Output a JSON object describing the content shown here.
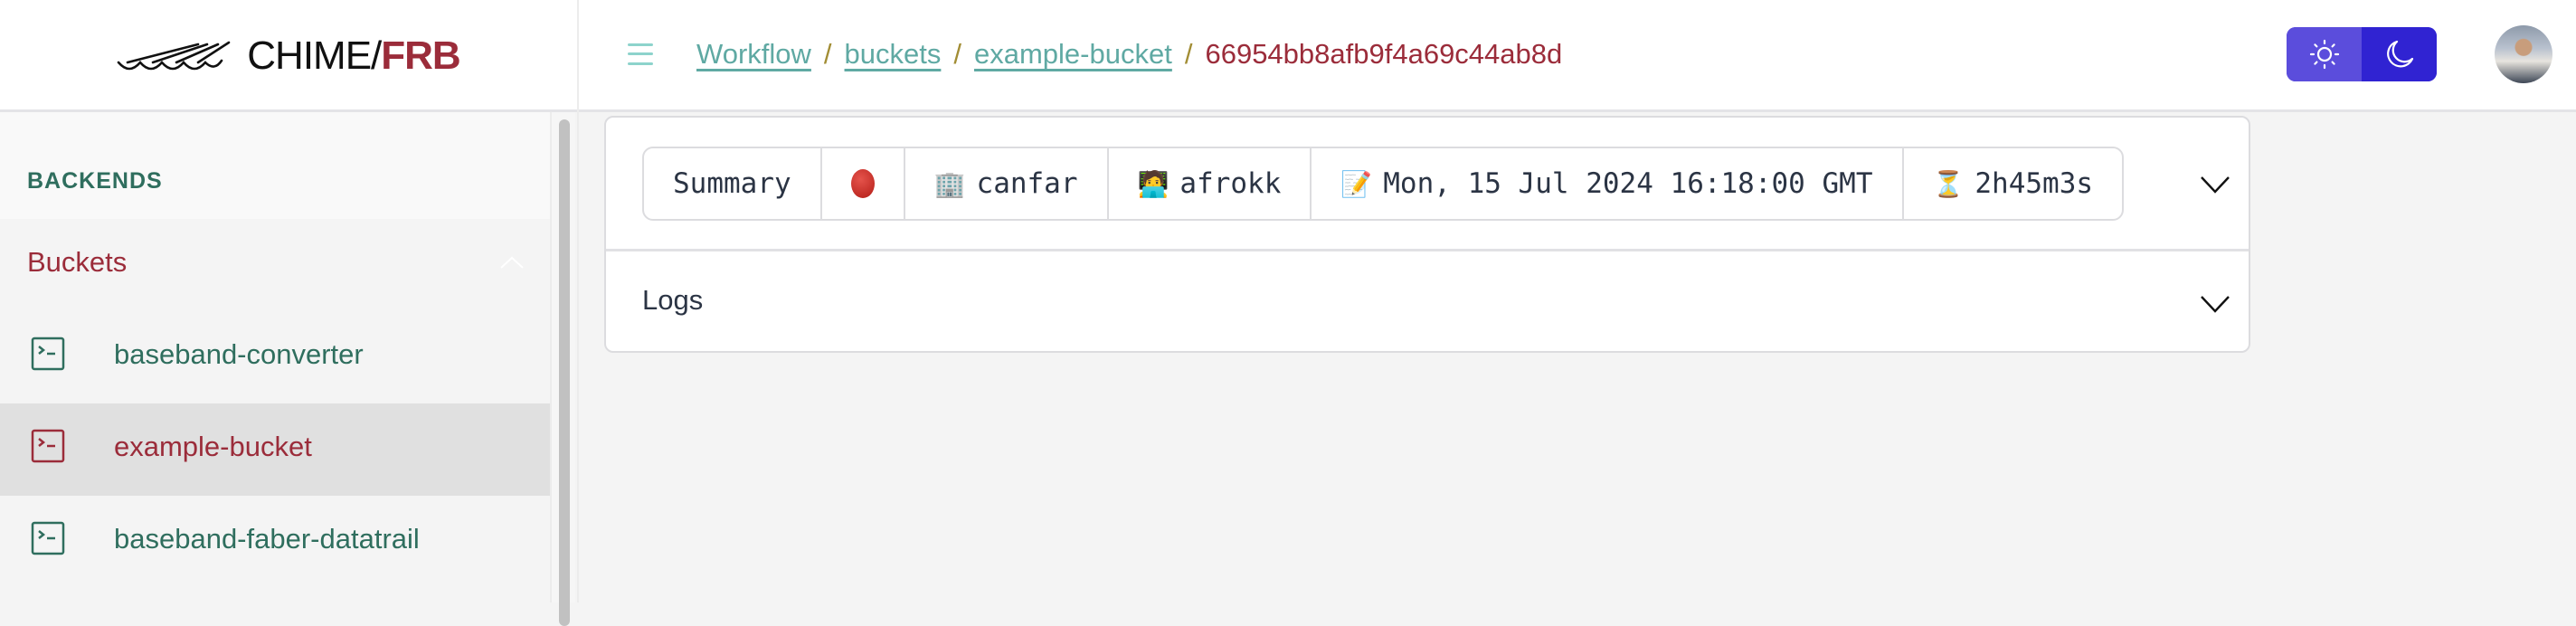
{
  "header": {
    "logo": {
      "text_main": "CHIME/",
      "text_accent": "FRB",
      "icon": "chime-telescope-logo-icon"
    },
    "menu_icon": "hamburger-menu-icon",
    "breadcrumb": [
      {
        "label": "Workflow",
        "link": true
      },
      {
        "label": "buckets",
        "link": true
      },
      {
        "label": "example-bucket",
        "link": true
      },
      {
        "label": "66954bb8afb9f4a69c44ab8d",
        "link": false
      }
    ],
    "breadcrumb_separator": "/",
    "theme_toggle": {
      "light_icon": "sun-icon",
      "dark_icon": "moon-icon",
      "active": "light"
    },
    "avatar_icon": "user-avatar"
  },
  "sidebar": {
    "section_title": "BACKENDS",
    "group": {
      "label": "Buckets",
      "expanded": true,
      "chevron_icon": "chevron-up-icon"
    },
    "items": [
      {
        "label": "baseband-converter",
        "icon": "terminal-icon",
        "active": false
      },
      {
        "label": "example-bucket",
        "icon": "terminal-icon",
        "active": true
      },
      {
        "label": "baseband-faber-datatrail",
        "icon": "terminal-icon",
        "active": false
      }
    ]
  },
  "main": {
    "summary": {
      "label": "Summary",
      "status": {
        "icon": "red-circle-icon",
        "color": "#c62a22"
      },
      "site": {
        "emoji": "🏢",
        "value": "canfar"
      },
      "user": {
        "emoji": "🧑‍💻",
        "value": "afrokk"
      },
      "created": {
        "emoji": "📝",
        "value": "Mon, 15 Jul 2024 16:18:00 GMT"
      },
      "duration": {
        "emoji": "⏳",
        "value": "2h45m3s"
      },
      "chevron_icon": "chevron-down-icon"
    },
    "logs": {
      "label": "Logs",
      "chevron_icon": "chevron-down-icon"
    }
  },
  "colors": {
    "accent_red": "#9b2c3a",
    "teal_link": "#5fa9a3",
    "green_text": "#2f6e5e",
    "toggle_indigo": "#3023d2"
  }
}
